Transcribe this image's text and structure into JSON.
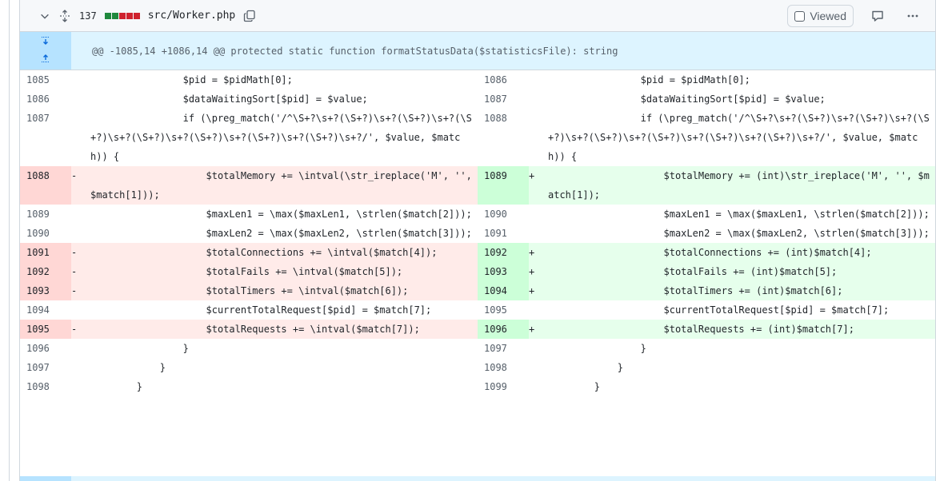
{
  "file": {
    "lines_changed": "137",
    "path": "src/Worker.php",
    "viewed_label": "Viewed",
    "diffstat_colors": [
      "#1f883d",
      "#1f883d",
      "#cf222e",
      "#cf222e",
      "#cf222e"
    ]
  },
  "hunk": {
    "header": "@@ -1085,14 +1086,14 @@ protected static function formatStatusData($statisticsFile): string"
  },
  "rows": [
    {
      "l_no": "1085",
      "l_code": "                $pid = $pidMath[0];",
      "r_no": "1086",
      "r_code": "                $pid = $pidMath[0];"
    },
    {
      "l_no": "1086",
      "l_code": "                $dataWaitingSort[$pid] = $value;",
      "r_no": "1087",
      "r_code": "                $dataWaitingSort[$pid] = $value;"
    },
    {
      "l_no": "1087",
      "l_code": "                if (\\preg_match('/^\\S+?\\s+?(\\S+?)\\s+?(\\S+?)\\s+?(\\S+?)\\s+?(\\S+?)\\s+?(\\S+?)\\s+?(\\S+?)\\s+?(\\S+?)\\s+?/', $value, $match)) {",
      "r_no": "1088",
      "r_code": "                if (\\preg_match('/^\\S+?\\s+?(\\S+?)\\s+?(\\S+?)\\s+?(\\S+?)\\s+?(\\S+?)\\s+?(\\S+?)\\s+?(\\S+?)\\s+?(\\S+?)\\s+?/', $value, $match)) {"
    },
    {
      "l_no": "1088",
      "l_mark": "-",
      "l_code": "                    $totalMemory += \\intval(\\str_ireplace('M', '', $match[1]));",
      "r_no": "1089",
      "r_mark": "+",
      "r_code": "                    $totalMemory += (int)\\str_ireplace('M', '', $match[1]);"
    },
    {
      "l_no": "1089",
      "l_code": "                    $maxLen1 = \\max($maxLen1, \\strlen($match[2]));",
      "r_no": "1090",
      "r_code": "                    $maxLen1 = \\max($maxLen1, \\strlen($match[2]));"
    },
    {
      "l_no": "1090",
      "l_code": "                    $maxLen2 = \\max($maxLen2, \\strlen($match[3]));",
      "r_no": "1091",
      "r_code": "                    $maxLen2 = \\max($maxLen2, \\strlen($match[3]));"
    },
    {
      "l_no": "1091",
      "l_mark": "-",
      "l_code": "                    $totalConnections += \\intval($match[4]);",
      "r_no": "1092",
      "r_mark": "+",
      "r_code": "                    $totalConnections += (int)$match[4];"
    },
    {
      "l_no": "1092",
      "l_mark": "-",
      "l_code": "                    $totalFails += \\intval($match[5]);",
      "r_no": "1093",
      "r_mark": "+",
      "r_code": "                    $totalFails += (int)$match[5];"
    },
    {
      "l_no": "1093",
      "l_mark": "-",
      "l_code": "                    $totalTimers += \\intval($match[6]);",
      "r_no": "1094",
      "r_mark": "+",
      "r_code": "                    $totalTimers += (int)$match[6];"
    },
    {
      "l_no": "1094",
      "l_code": "                    $currentTotalRequest[$pid] = $match[7];",
      "r_no": "1095",
      "r_code": "                    $currentTotalRequest[$pid] = $match[7];"
    },
    {
      "l_no": "1095",
      "l_mark": "-",
      "l_code": "                    $totalRequests += \\intval($match[7]);",
      "r_no": "1096",
      "r_mark": "+",
      "r_code": "                    $totalRequests += (int)$match[7];"
    },
    {
      "l_no": "1096",
      "l_code": "                }",
      "r_no": "1097",
      "r_code": "                }"
    },
    {
      "l_no": "1097",
      "l_code": "            }",
      "r_no": "1098",
      "r_code": "            }"
    },
    {
      "l_no": "1098",
      "l_code": "        }",
      "r_no": "1099",
      "r_code": "        }"
    }
  ],
  "icons": {
    "collapse": "chevron-down-icon",
    "unfold": "unfold-icon",
    "copy": "copy-icon",
    "comment": "comment-icon",
    "more": "kebab-horizontal-icon",
    "expand_up": "fold-up-icon",
    "expand_down": "fold-down-icon"
  }
}
